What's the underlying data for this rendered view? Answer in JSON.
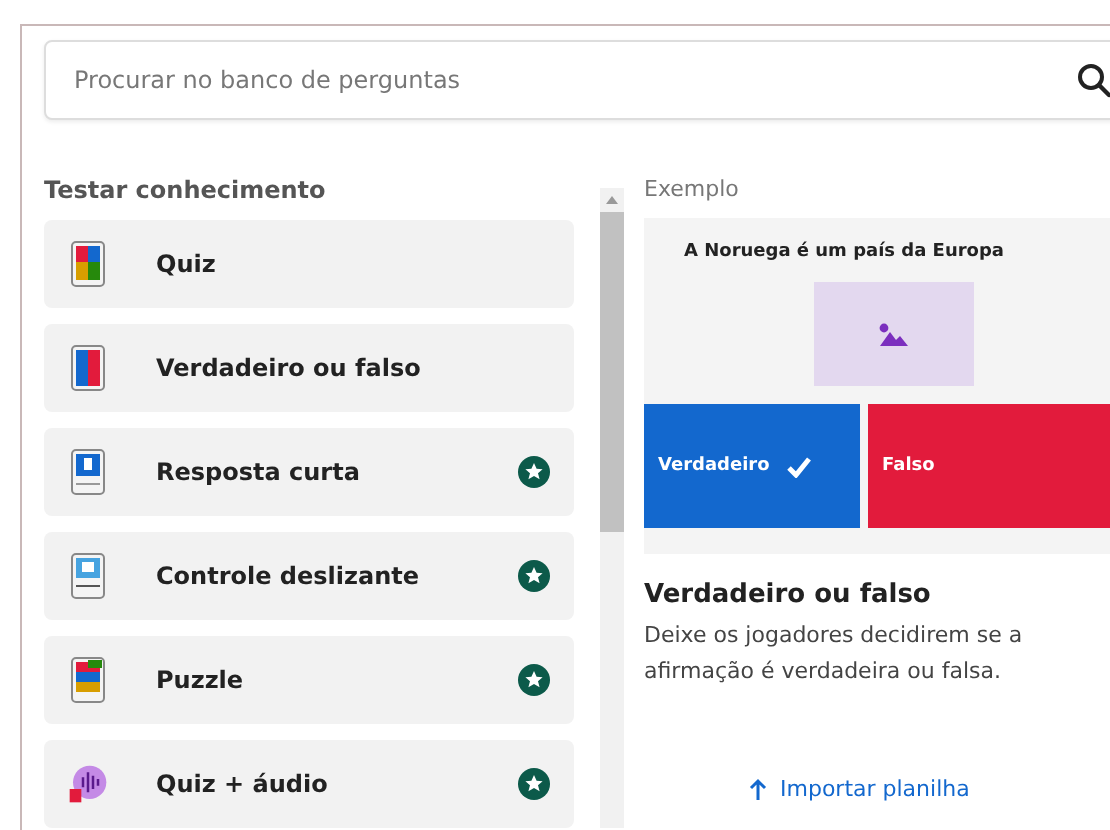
{
  "search": {
    "placeholder": "Procurar no banco de perguntas"
  },
  "section": {
    "title": "Testar conhecimento"
  },
  "items": [
    {
      "label": "Quiz",
      "kind": "quiz",
      "premium": false
    },
    {
      "label": "Verdadeiro ou falso",
      "kind": "truefalse",
      "premium": false
    },
    {
      "label": "Resposta curta",
      "kind": "short",
      "premium": true
    },
    {
      "label": "Controle deslizante",
      "kind": "slider",
      "premium": true
    },
    {
      "label": "Puzzle",
      "kind": "puzzle",
      "premium": true
    },
    {
      "label": "Quiz + áudio",
      "kind": "audio",
      "premium": true
    }
  ],
  "example": {
    "heading": "Exemplo",
    "question": "A Noruega é um país da Europa",
    "answers": [
      {
        "label": "Verdadeiro",
        "correct": true,
        "color": "#1368ce"
      },
      {
        "label": "Falso",
        "correct": false,
        "color": "#e21b3c"
      }
    ],
    "title": "Verdadeiro ou falso",
    "description": "Deixe os jogadores decidirem se a afirmação é verdadeira ou falsa."
  },
  "import_button": {
    "label": "Importar planilha"
  }
}
